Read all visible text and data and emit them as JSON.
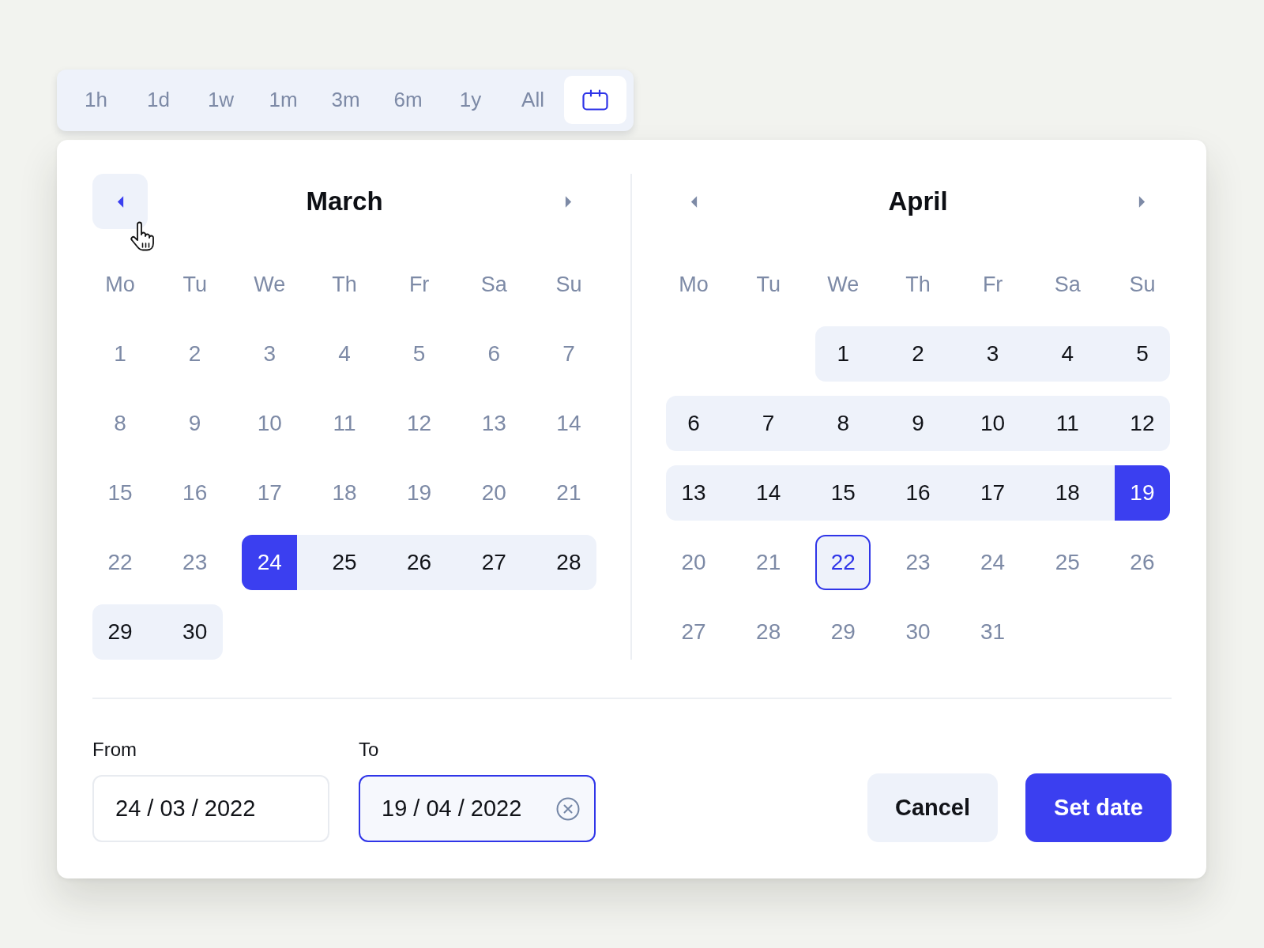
{
  "presets": [
    {
      "label": "1h",
      "selected": false
    },
    {
      "label": "1d",
      "selected": false
    },
    {
      "label": "1w",
      "selected": false
    },
    {
      "label": "1m",
      "selected": false
    },
    {
      "label": "3m",
      "selected": false
    },
    {
      "label": "6m",
      "selected": false
    },
    {
      "label": "1y",
      "selected": false
    },
    {
      "label": "All",
      "selected": false
    }
  ],
  "calendar_button": {
    "selected": true
  },
  "months": [
    {
      "title": "March",
      "nav": [
        {
          "kind": "prev",
          "hovered": true
        },
        {
          "kind": "next",
          "hovered": false
        }
      ],
      "weekdays": [
        "Mo",
        "Tu",
        "We",
        "Th",
        "Fr",
        "Sa",
        "Su"
      ],
      "weeks": [
        {
          "days": [
            {
              "label": "1",
              "in_range": false,
              "selected": false,
              "today": false
            },
            {
              "label": "2",
              "in_range": false,
              "selected": false,
              "today": false
            },
            {
              "label": "3",
              "in_range": false,
              "selected": false,
              "today": false
            },
            {
              "label": "4",
              "in_range": false,
              "selected": false,
              "today": false
            },
            {
              "label": "5",
              "in_range": false,
              "selected": false,
              "today": false
            },
            {
              "label": "6",
              "in_range": false,
              "selected": false,
              "today": false
            },
            {
              "label": "7",
              "in_range": false,
              "selected": false,
              "today": false
            }
          ]
        },
        {
          "days": [
            {
              "label": "8",
              "in_range": false,
              "selected": false,
              "today": false
            },
            {
              "label": "9",
              "in_range": false,
              "selected": false,
              "today": false
            },
            {
              "label": "10",
              "in_range": false,
              "selected": false,
              "today": false
            },
            {
              "label": "11",
              "in_range": false,
              "selected": false,
              "today": false
            },
            {
              "label": "12",
              "in_range": false,
              "selected": false,
              "today": false
            },
            {
              "label": "13",
              "in_range": false,
              "selected": false,
              "today": false
            },
            {
              "label": "14",
              "in_range": false,
              "selected": false,
              "today": false
            }
          ]
        },
        {
          "days": [
            {
              "label": "15",
              "in_range": false,
              "selected": false,
              "today": false
            },
            {
              "label": "16",
              "in_range": false,
              "selected": false,
              "today": false
            },
            {
              "label": "17",
              "in_range": false,
              "selected": false,
              "today": false
            },
            {
              "label": "18",
              "in_range": false,
              "selected": false,
              "today": false
            },
            {
              "label": "19",
              "in_range": false,
              "selected": false,
              "today": false
            },
            {
              "label": "20",
              "in_range": false,
              "selected": false,
              "today": false
            },
            {
              "label": "21",
              "in_range": false,
              "selected": false,
              "today": false
            }
          ]
        },
        {
          "days": [
            {
              "label": "22",
              "in_range": false,
              "selected": false,
              "today": false
            },
            {
              "label": "23",
              "in_range": false,
              "selected": false,
              "today": false
            },
            {
              "label": "24",
              "in_range": true,
              "selected": true,
              "today": false
            },
            {
              "label": "25",
              "in_range": true,
              "selected": false,
              "today": false
            },
            {
              "label": "26",
              "in_range": true,
              "selected": false,
              "today": false
            },
            {
              "label": "27",
              "in_range": true,
              "selected": false,
              "today": false
            },
            {
              "label": "28",
              "in_range": true,
              "selected": false,
              "today": false
            }
          ]
        },
        {
          "days": [
            {
              "label": "29",
              "in_range": true,
              "selected": false,
              "today": false
            },
            {
              "label": "30",
              "in_range": true,
              "selected": false,
              "today": false
            }
          ]
        }
      ]
    },
    {
      "title": "April",
      "nav": [
        {
          "kind": "prev",
          "hovered": false
        },
        {
          "kind": "next",
          "hovered": false
        }
      ],
      "weekdays": [
        "Mo",
        "Tu",
        "We",
        "Th",
        "Fr",
        "Sa",
        "Su"
      ],
      "weeks": [
        {
          "days": [
            {
              "label": "1",
              "in_range": true,
              "selected": false,
              "today": false
            },
            {
              "label": "2",
              "in_range": true,
              "selected": false,
              "today": false
            },
            {
              "label": "3",
              "in_range": true,
              "selected": false,
              "today": false
            },
            {
              "label": "4",
              "in_range": true,
              "selected": false,
              "today": false
            },
            {
              "label": "5",
              "in_range": true,
              "selected": false,
              "today": false
            }
          ]
        },
        {
          "days": [
            {
              "label": "6",
              "in_range": true,
              "selected": false,
              "today": false
            },
            {
              "label": "7",
              "in_range": true,
              "selected": false,
              "today": false
            },
            {
              "label": "8",
              "in_range": true,
              "selected": false,
              "today": false
            },
            {
              "label": "9",
              "in_range": true,
              "selected": false,
              "today": false
            },
            {
              "label": "10",
              "in_range": true,
              "selected": false,
              "today": false
            },
            {
              "label": "11",
              "in_range": true,
              "selected": false,
              "today": false
            },
            {
              "label": "12",
              "in_range": true,
              "selected": false,
              "today": false
            }
          ]
        },
        {
          "days": [
            {
              "label": "13",
              "in_range": true,
              "selected": false,
              "today": false
            },
            {
              "label": "14",
              "in_range": true,
              "selected": false,
              "today": false
            },
            {
              "label": "15",
              "in_range": true,
              "selected": false,
              "today": false
            },
            {
              "label": "16",
              "in_range": true,
              "selected": false,
              "today": false
            },
            {
              "label": "17",
              "in_range": true,
              "selected": false,
              "today": false
            },
            {
              "label": "18",
              "in_range": true,
              "selected": false,
              "today": false
            },
            {
              "label": "19",
              "in_range": true,
              "selected": true,
              "today": false
            }
          ]
        },
        {
          "days": [
            {
              "label": "20",
              "in_range": false,
              "selected": false,
              "today": false
            },
            {
              "label": "21",
              "in_range": false,
              "selected": false,
              "today": false
            },
            {
              "label": "22",
              "in_range": false,
              "selected": false,
              "today": true
            },
            {
              "label": "23",
              "in_range": false,
              "selected": false,
              "today": false
            },
            {
              "label": "24",
              "in_range": false,
              "selected": false,
              "today": false
            },
            {
              "label": "25",
              "in_range": false,
              "selected": false,
              "today": false
            },
            {
              "label": "26",
              "in_range": false,
              "selected": false,
              "today": false
            }
          ]
        },
        {
          "days": [
            {
              "label": "27",
              "in_range": false,
              "selected": false,
              "today": false
            },
            {
              "label": "28",
              "in_range": false,
              "selected": false,
              "today": false
            },
            {
              "label": "29",
              "in_range": false,
              "selected": false,
              "today": false
            },
            {
              "label": "30",
              "in_range": false,
              "selected": false,
              "today": false
            },
            {
              "label": "31",
              "in_range": false,
              "selected": false,
              "today": false
            }
          ]
        }
      ]
    }
  ],
  "fields": [
    {
      "label": "From",
      "value": "24 / 03 / 2022",
      "focused": false,
      "clearable": false
    },
    {
      "label": "To",
      "value": "19 / 04 / 2022",
      "focused": true,
      "clearable": true
    }
  ],
  "buttons": [
    {
      "label": "Cancel",
      "kind": "secondary"
    },
    {
      "label": "Set date",
      "kind": "primary"
    }
  ]
}
